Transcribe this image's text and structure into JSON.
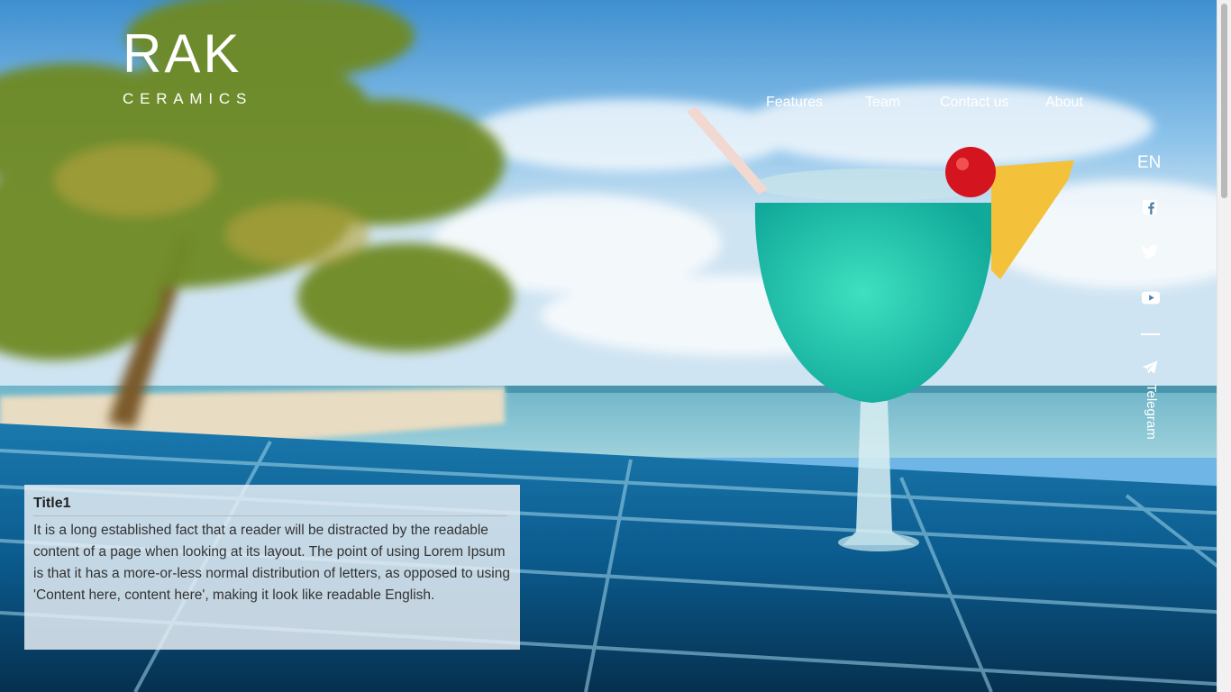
{
  "brand": {
    "name": "RAK",
    "subtitle": "CERAMICS"
  },
  "nav": {
    "items": [
      "Features",
      "Team",
      "Contact us",
      "About"
    ]
  },
  "rail": {
    "language": "EN",
    "social": [
      {
        "icon": "facebook-icon"
      },
      {
        "icon": "twitter-icon"
      },
      {
        "icon": "youtube-icon"
      },
      {
        "icon": "telegram-icon"
      }
    ],
    "telegram_label": "Telegram"
  },
  "card": {
    "title": "Title1",
    "body": "It is a long established fact that a reader will be distracted by the readable content of a page when looking at its layout. The point of using Lorem Ipsum is that it has a more-or-less normal distribution of letters, as opposed to using 'Content here, content here', making it look like readable English."
  },
  "colors": {
    "text_on_image": "#ffffff",
    "card_background": "#e8f0f5",
    "card_text": "#333333"
  }
}
